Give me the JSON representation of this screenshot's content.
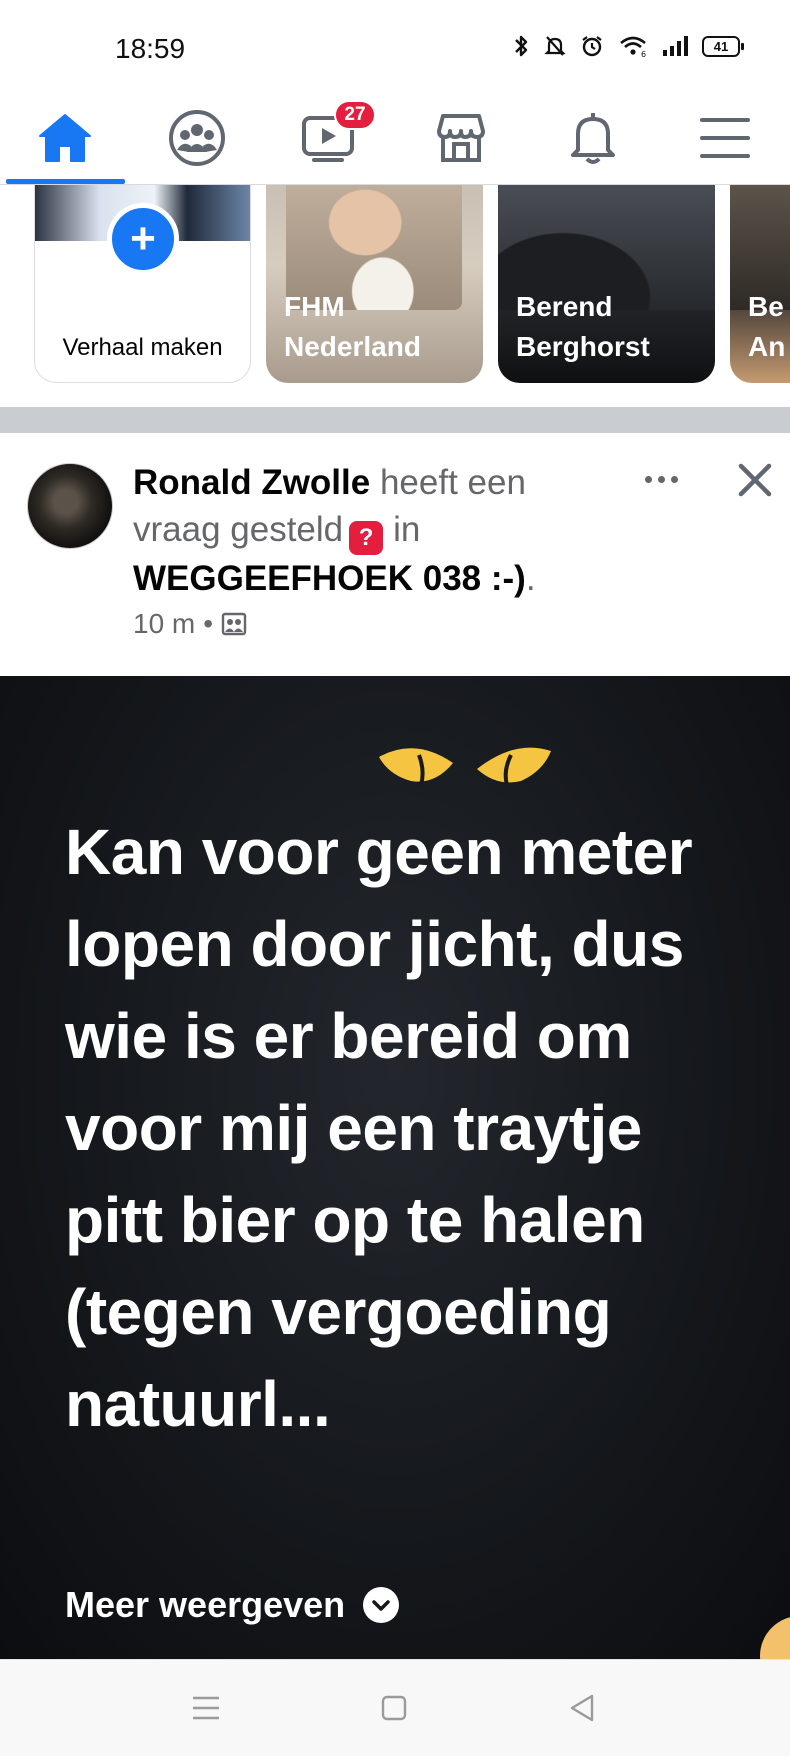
{
  "status_bar": {
    "time": "18:59",
    "battery_level": "41",
    "icons": [
      "bluetooth-icon",
      "mute-bell-icon",
      "alarm-icon",
      "wifi-icon",
      "signal-icon",
      "battery-icon"
    ]
  },
  "nav": {
    "items": [
      {
        "name": "home",
        "icon": "home-icon",
        "active": true
      },
      {
        "name": "groups",
        "icon": "groups-icon"
      },
      {
        "name": "watch",
        "icon": "video-icon",
        "badge": "27"
      },
      {
        "name": "marketplace",
        "icon": "store-icon"
      },
      {
        "name": "notifications",
        "icon": "bell-icon"
      },
      {
        "name": "menu",
        "icon": "menu-icon"
      }
    ],
    "accent_color": "#1877f2",
    "badge_color": "#e41e3f"
  },
  "stories": {
    "create_label": "Verhaal maken",
    "items": [
      {
        "title": "FHM\nNederland"
      },
      {
        "title": "Berend\nBerghorst"
      },
      {
        "title": "Be\nAn"
      }
    ]
  },
  "post": {
    "author": "Ronald Zwolle",
    "action_text": "heeft een vraag gesteld",
    "preposition": "in",
    "group": "WEGGEEFHOEK 038 :-)",
    "trailing": ".",
    "time": "10 m",
    "dot": "•",
    "audience_icon": "group-audience-icon",
    "question_icon_glyph": "?",
    "message": "Kan voor geen meter lopen door jicht, dus wie is er bereid om voor mij een traytje pitt bier op te halen (tegen vergoeding natuurl...",
    "see_more": "Meer weergeven"
  },
  "system_nav": [
    "recent-apps-icon",
    "home-square-icon",
    "back-triangle-icon"
  ]
}
